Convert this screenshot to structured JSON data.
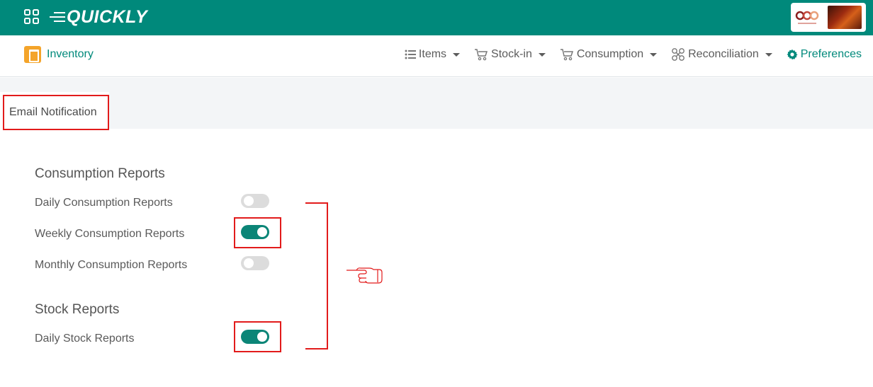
{
  "topbar": {
    "brand": "QUICKLY",
    "icons": {
      "apps": "apps-grid-icon",
      "brand_lines": "speed-lines-icon"
    },
    "company_logo": "company-logo",
    "company_photo": "company-photo"
  },
  "navbar": {
    "app_name": "Inventory",
    "app_icon": "inventory-app-icon",
    "menu": [
      {
        "label": "Items",
        "icon": "list-icon",
        "has_caret": true
      },
      {
        "label": "Stock-in",
        "icon": "cart-icon",
        "has_caret": true
      },
      {
        "label": "Consumption",
        "icon": "cart-icon",
        "has_caret": true
      },
      {
        "label": "Reconciliation",
        "icon": "reconcile-icon",
        "has_caret": true
      },
      {
        "label": "Preferences",
        "icon": "gear-icon",
        "has_caret": false,
        "active": true
      }
    ]
  },
  "tab": {
    "label": "Email Notification"
  },
  "sections": [
    {
      "title": "Consumption Reports",
      "rows": [
        {
          "label": "Daily Consumption Reports",
          "enabled": false
        },
        {
          "label": "Weekly Consumption Reports",
          "enabled": true
        },
        {
          "label": "Monthly Consumption Reports",
          "enabled": false
        }
      ]
    },
    {
      "title": "Stock Reports",
      "rows": [
        {
          "label": "Daily Stock Reports",
          "enabled": true
        }
      ]
    }
  ],
  "colors": {
    "brand_teal": "#00897b",
    "toggle_on": "#0b8577",
    "toggle_off": "#dcdcdc",
    "annotation_red": "#e21b1b",
    "page_gray": "#f3f5f7"
  },
  "annotations": {
    "pointer_icon": "pointing-hand-icon"
  }
}
